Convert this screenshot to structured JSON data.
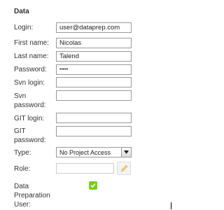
{
  "section": {
    "title": "Data"
  },
  "labels": {
    "login": "Login:",
    "first_name": "First name:",
    "last_name": "Last name:",
    "password": "Password:",
    "svn_login": "Svn login:",
    "svn_password": "Svn password:",
    "git_login": "GIT login:",
    "git_password": "GIT password:",
    "type": "Type:",
    "role": "Role:",
    "data_prep_user": "Data Preparation User:"
  },
  "fields": {
    "login": "user@dataprep.com",
    "first_name": "Nicolas",
    "last_name": "Talend",
    "password": "•••••",
    "svn_login": "",
    "svn_password": "",
    "git_login": "",
    "git_password": ""
  },
  "type_select": {
    "selected": "No Project Access"
  },
  "role": {
    "value": ""
  },
  "data_prep_user": {
    "checked": true
  },
  "colors": {
    "checkbox": "#7ccc1c",
    "border": "#999999"
  },
  "icons": {
    "type_dropdown": "chevron-down-icon",
    "role_edit": "pencil-icon",
    "check": "check-icon"
  }
}
